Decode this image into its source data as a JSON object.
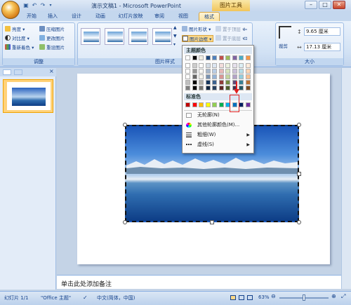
{
  "window": {
    "title": "演示文稿1 - Microsoft PowerPoint",
    "context_tab_title": "图片工具",
    "controls": [
      "–",
      "□",
      "✕"
    ]
  },
  "tabs": [
    "开始",
    "插入",
    "设计",
    "动画",
    "幻灯片放映",
    "审阅",
    "视图",
    "格式"
  ],
  "ribbon": {
    "adjust": {
      "title": "调整",
      "buttons": [
        "亮度",
        "对比度",
        "重新着色",
        "压缩图片",
        "更改图片",
        "重设图片"
      ]
    },
    "picture_styles": {
      "title": "图片样式",
      "buttons": [
        "图片形状",
        "图片边框",
        "图片效果"
      ]
    },
    "arrange": {
      "buttons": [
        "置于顶层",
        "置于底层"
      ]
    },
    "size": {
      "title": "大小",
      "crop": "裁剪",
      "height": "9.65 厘米",
      "width": "17.13 厘米"
    }
  },
  "dropdown": {
    "theme_colors_label": "主题颜色",
    "standard_colors_label": "标准色",
    "theme_colors": [
      "#ffffff",
      "#000000",
      "#eeece1",
      "#1f497d",
      "#4f81bd",
      "#c0504d",
      "#9bbb59",
      "#8064a2",
      "#4bacc6",
      "#f79646"
    ],
    "standard_colors": [
      "#c00000",
      "#ff0000",
      "#ffc000",
      "#ffff00",
      "#92d050",
      "#00b050",
      "#00b0f0",
      "#0070c0",
      "#002060",
      "#7030a0"
    ],
    "items": [
      "无轮廓(N)",
      "其他轮廓颜色(M)...",
      "粗细(W)",
      "虚线(S)"
    ]
  },
  "notes_placeholder": "单击此处添加备注",
  "status": {
    "slide": "幻灯片 1/1",
    "theme": "\"Office 主题\"",
    "language": "中文(简体，中国)",
    "zoom": "63%"
  },
  "slide_number": "1"
}
